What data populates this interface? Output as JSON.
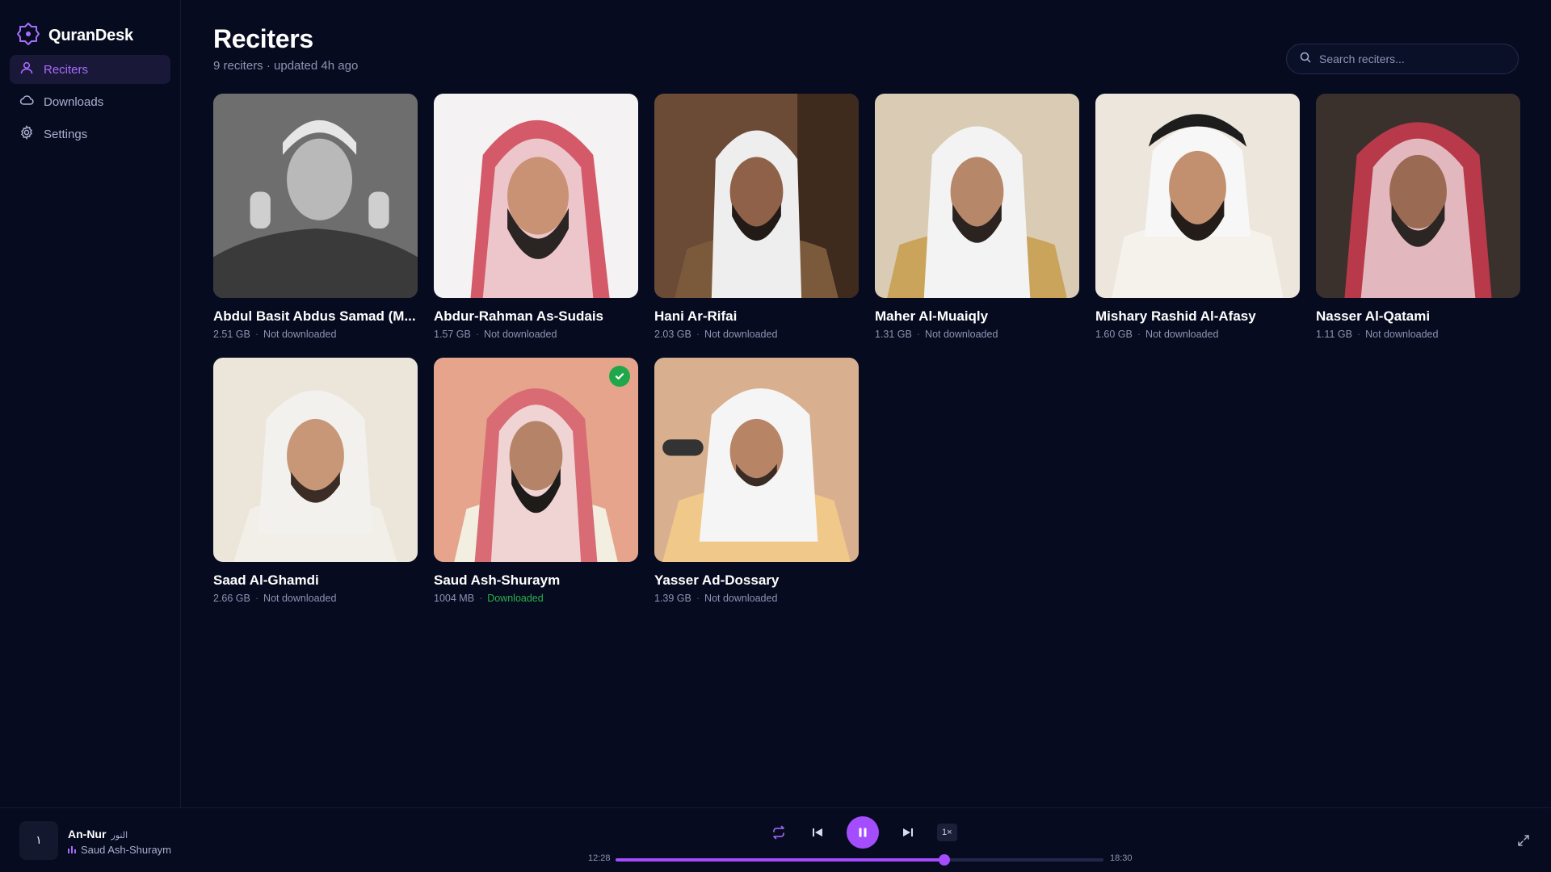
{
  "app": {
    "name": "QuranDesk",
    "accent": "#a44dff"
  },
  "sidebar": {
    "items": [
      {
        "label": "Reciters",
        "icon": "user-icon",
        "active": true
      },
      {
        "label": "Downloads",
        "icon": "cloud-icon",
        "active": false
      },
      {
        "label": "Settings",
        "icon": "gear-icon",
        "active": false
      }
    ]
  },
  "header": {
    "title": "Reciters",
    "subtitle": "9 reciters · updated 4h ago",
    "search_placeholder": "Search reciters..."
  },
  "reciters": [
    {
      "name": "Abdul Basit Abdus Samad (M...",
      "size": "2.51 GB",
      "status": "Not downloaded",
      "downloaded": false
    },
    {
      "name": "Abdur-Rahman As-Sudais",
      "size": "1.57 GB",
      "status": "Not downloaded",
      "downloaded": false
    },
    {
      "name": "Hani Ar-Rifai",
      "size": "2.03 GB",
      "status": "Not downloaded",
      "downloaded": false
    },
    {
      "name": "Maher Al-Muaiqly",
      "size": "1.31 GB",
      "status": "Not downloaded",
      "downloaded": false
    },
    {
      "name": "Mishary Rashid Al-Afasy",
      "size": "1.60 GB",
      "status": "Not downloaded",
      "downloaded": false
    },
    {
      "name": "Nasser Al-Qatami",
      "size": "1.11 GB",
      "status": "Not downloaded",
      "downloaded": false
    },
    {
      "name": "Saad Al-Ghamdi",
      "size": "2.66 GB",
      "status": "Not downloaded",
      "downloaded": false
    },
    {
      "name": "Saud Ash-Shuraym",
      "size": "1004 MB",
      "status": "Downloaded",
      "downloaded": true
    },
    {
      "name": "Yasser Ad-Dossary",
      "size": "1.39 GB",
      "status": "Not downloaded",
      "downloaded": false
    }
  ],
  "player": {
    "thumb_glyph": "١",
    "track_title": "An-Nur",
    "track_arabic": "النور",
    "artist": "Saud Ash-Shuraym",
    "elapsed": "12:28",
    "duration": "18:30",
    "progress": 0.674,
    "speed": "1×",
    "playing": true
  }
}
